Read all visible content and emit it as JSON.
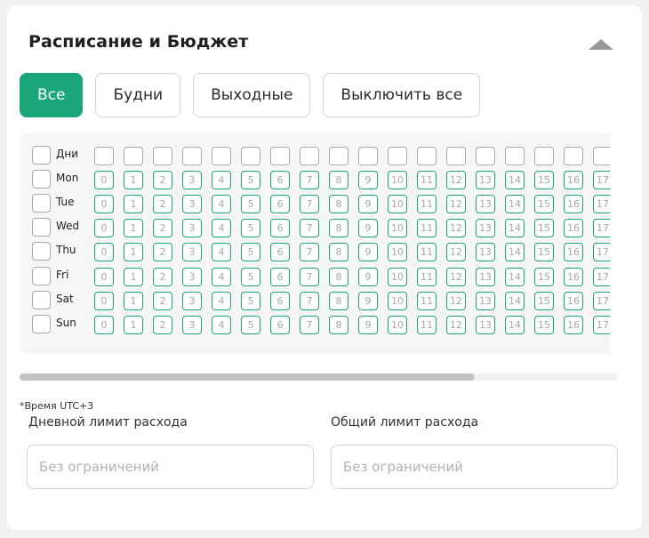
{
  "panel": {
    "title": "Расписание и Бюджет"
  },
  "filters": [
    {
      "id": "all",
      "label": "Все",
      "active": true
    },
    {
      "id": "weekdays",
      "label": "Будни",
      "active": false
    },
    {
      "id": "weekends",
      "label": "Выходные",
      "active": false
    },
    {
      "id": "off",
      "label": "Выключить все",
      "active": false
    }
  ],
  "schedule": {
    "header_label": "Дни",
    "days": [
      "Mon",
      "Tue",
      "Wed",
      "Thu",
      "Fri",
      "Sat",
      "Sun"
    ],
    "hours_visible": [
      "0",
      "1",
      "2",
      "3",
      "4",
      "5",
      "6",
      "7",
      "8",
      "9",
      "10",
      "11",
      "12",
      "13",
      "14",
      "15",
      "16",
      "17"
    ],
    "accent_color": "#1aa57b"
  },
  "footer": {
    "timezone_note": "*Время UTC+3",
    "daily_limit_label": "Дневной лимит расхода",
    "daily_limit_placeholder": "Без ограничений",
    "total_limit_label": "Общий лимит расхода",
    "total_limit_placeholder": "Без ограничений"
  }
}
